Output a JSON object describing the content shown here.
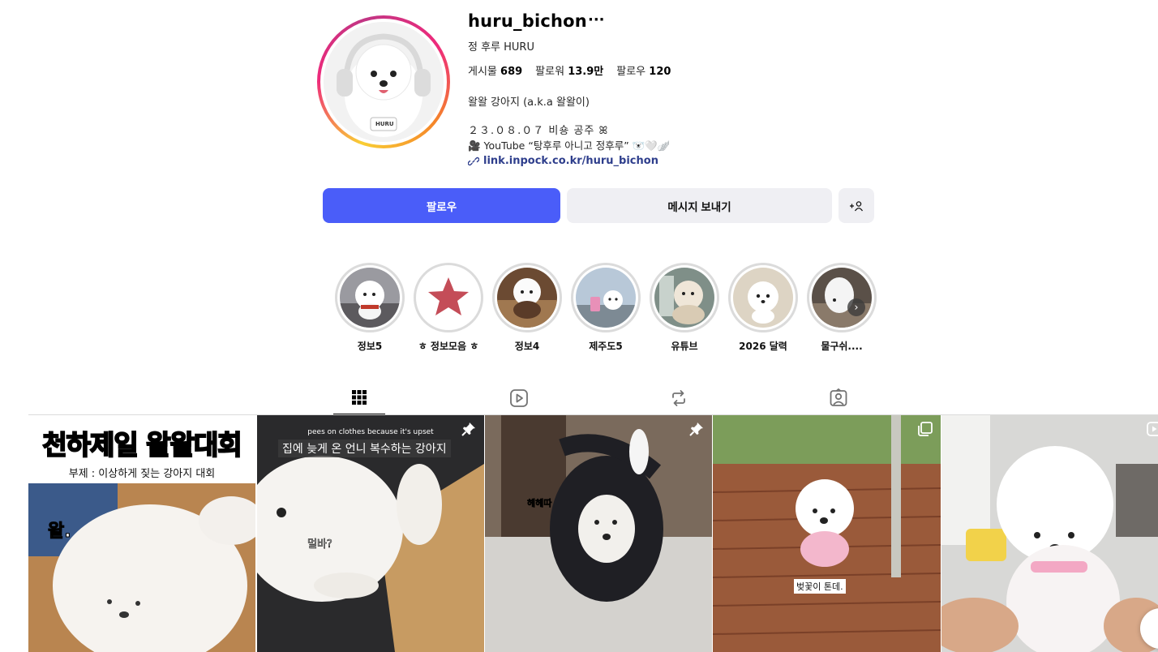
{
  "profile": {
    "username": "huru_bichon",
    "more_label": "···",
    "full_name": "정 후루 HURU",
    "stats": {
      "posts_label": "게시물",
      "posts_value": "689",
      "followers_label": "팔로워",
      "followers_value": "13.9만",
      "following_label": "팔로우",
      "following_value": "120"
    },
    "bio_line1": "왈왈 강아지 (a.k.a 왈왈이)",
    "bio_line2": "２３.０８.０７ 비숑 공주 ꕤ",
    "bio_line3": "🎥 YouTube “탕후루 아니고 정후루” 🐻‍❄️🤍🪽",
    "link": "link.inpock.co.kr/huru_bichon",
    "avatar_badge": "HURU"
  },
  "actions": {
    "follow": "팔로우",
    "message": "메시지 보내기",
    "suggest_icon": "add-person-icon"
  },
  "highlights": [
    {
      "label": "정보5"
    },
    {
      "label": "ㅎ 정보모음 ㅎ"
    },
    {
      "label": "정보4"
    },
    {
      "label": "제주도5"
    },
    {
      "label": "유튜브"
    },
    {
      "label": "2026 달력"
    },
    {
      "label": "물구쉬...."
    }
  ],
  "tabs": [
    {
      "name": "grid-icon",
      "active": true
    },
    {
      "name": "reels-icon",
      "active": false
    },
    {
      "name": "reposts-icon",
      "active": false
    },
    {
      "name": "tagged-icon",
      "active": false
    }
  ],
  "posts": {
    "p1_title": "천하제일 왈왈대회",
    "p1_subtitle": "부제 : 이상하게 짖는 강아지 대회",
    "p1_sticker": "왈.",
    "p2_caption_en": "pees on clothes because it's upset",
    "p2_caption_ko": "집에 늦게 온 언니 복수하는 강아지",
    "p2_sticker": "멀바?",
    "p3_sticker": "헤헤따",
    "p4_caption": "벚꽃이 톤데."
  },
  "colors": {
    "follow_button": "#4a5df9",
    "secondary_button": "#efeff3",
    "link": "#2e3e8c"
  }
}
